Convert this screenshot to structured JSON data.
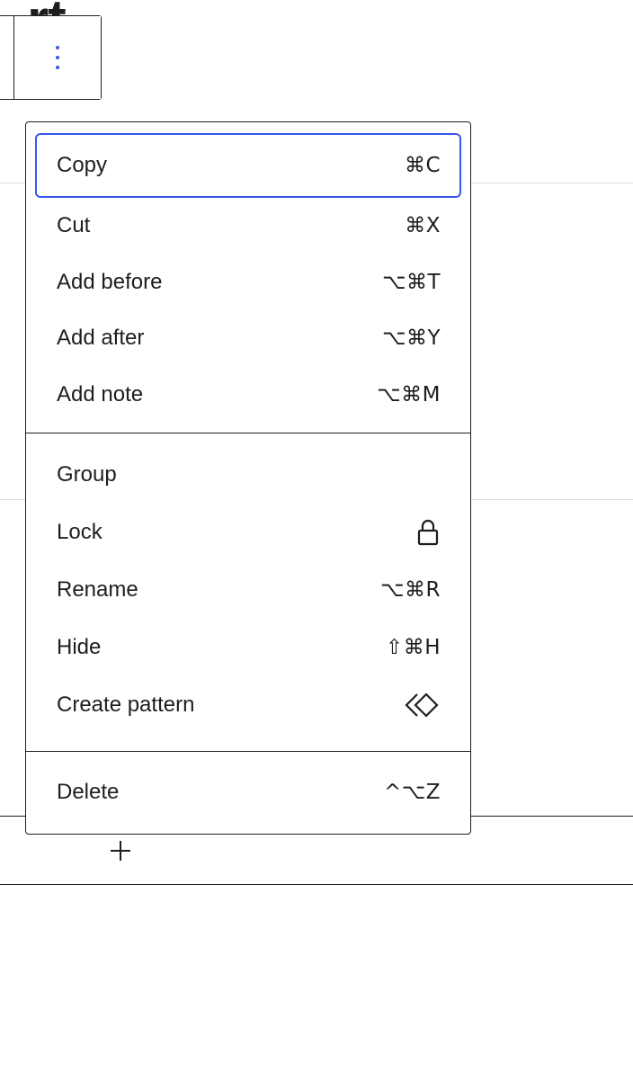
{
  "editor": {
    "heading_fragment": "rt",
    "options_icon": "vertical-ellipsis-icon",
    "add_icon": "plus-icon"
  },
  "menu": {
    "groups": [
      {
        "items": [
          {
            "label": "Copy",
            "shortcut": "⌘C"
          },
          {
            "label": "Cut",
            "shortcut": "⌘X"
          },
          {
            "label": "Add before",
            "shortcut": "⌥⌘T"
          },
          {
            "label": "Add after",
            "shortcut": "⌥⌘Y"
          },
          {
            "label": "Add note",
            "shortcut": "⌥⌘M"
          }
        ]
      },
      {
        "items": [
          {
            "label": "Group"
          },
          {
            "label": "Lock",
            "icon": "lock-icon"
          },
          {
            "label": "Rename",
            "shortcut": "⌥⌘R"
          },
          {
            "label": "Hide",
            "shortcut": "⇧⌘H"
          },
          {
            "label": "Create pattern",
            "icon": "pattern-icon"
          }
        ]
      },
      {
        "items": [
          {
            "label": "Delete",
            "shortcut": "^⌥Z"
          }
        ]
      }
    ]
  },
  "colors": {
    "focus": "#3858e9",
    "text": "#1e1e1e",
    "divider_light": "#dddddd"
  }
}
